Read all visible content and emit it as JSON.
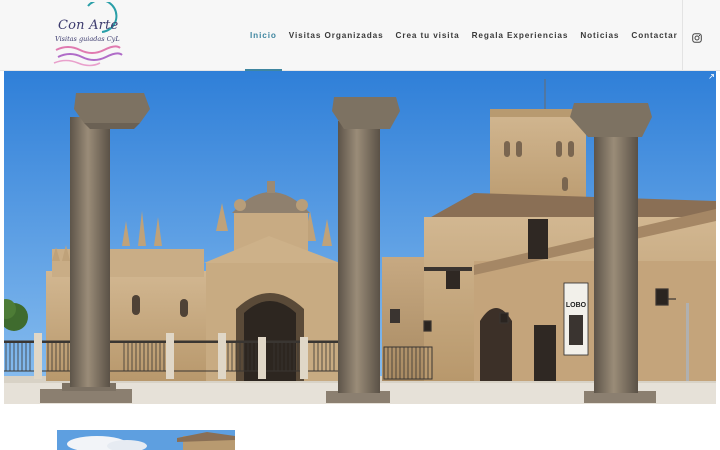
{
  "header": {
    "logo": {
      "title": "Con Arte",
      "subtitle": "Visitas guiadas CyL"
    },
    "nav": [
      {
        "label": "Inicio",
        "active": true
      },
      {
        "label": "Visitas Organizadas",
        "active": false
      },
      {
        "label": "Crea tu visita",
        "active": false
      },
      {
        "label": "Regala Experiencias",
        "active": false
      },
      {
        "label": "Noticias",
        "active": false
      },
      {
        "label": "Contactar",
        "active": false
      }
    ],
    "social_icon": "instagram-icon"
  },
  "hero": {
    "banner_text": "LOBO"
  },
  "colors": {
    "accent": "#3f86a0",
    "nav_text": "#3a3a3a",
    "logo_text": "#3c3b6e",
    "logo_swirl": "#e07ab0",
    "sky": "#3f8fe0",
    "stone": "#c9b08a"
  }
}
